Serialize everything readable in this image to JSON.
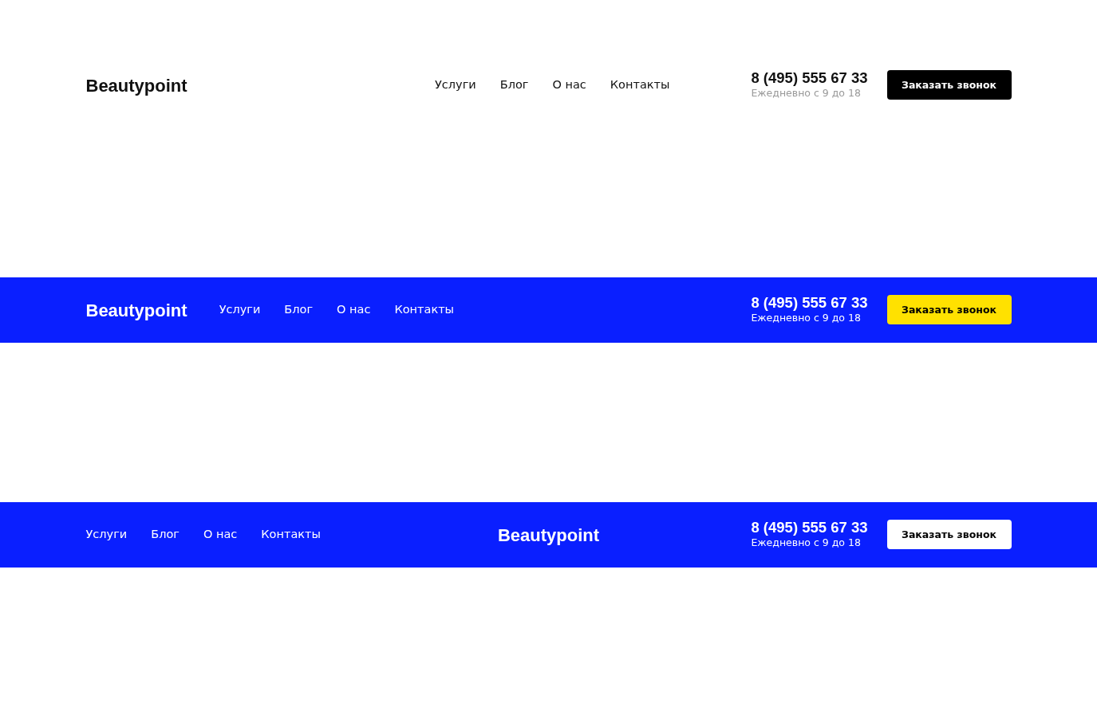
{
  "headers": [
    {
      "kind": "light-spread",
      "logo": "Beautypoint",
      "nav": [
        "Услуги",
        "Блог",
        "О нас",
        "Контакты"
      ],
      "phone": "8 (495) 555 67 33",
      "hours": "Ежедневно с 9 до 18",
      "button": {
        "label": "Заказать звонок",
        "kind": "dark"
      }
    },
    {
      "kind": "blue-left",
      "logo": "Beautypoint",
      "nav": [
        "Услуги",
        "Блог",
        "О нас",
        "Контакты"
      ],
      "phone": "8 (495) 555 67 33",
      "hours": "Ежедневно с 9 до 18",
      "button": {
        "label": "Заказать звонок",
        "kind": "yellow"
      }
    },
    {
      "kind": "blue-center",
      "logo": "Beautypoint",
      "nav": [
        "Услуги",
        "Блог",
        "О нас",
        "Контакты"
      ],
      "phone": "8 (495) 555 67 33",
      "hours": "Ежедневно с 9 до 18",
      "button": {
        "label": "Заказать звонок",
        "kind": "white"
      }
    }
  ]
}
